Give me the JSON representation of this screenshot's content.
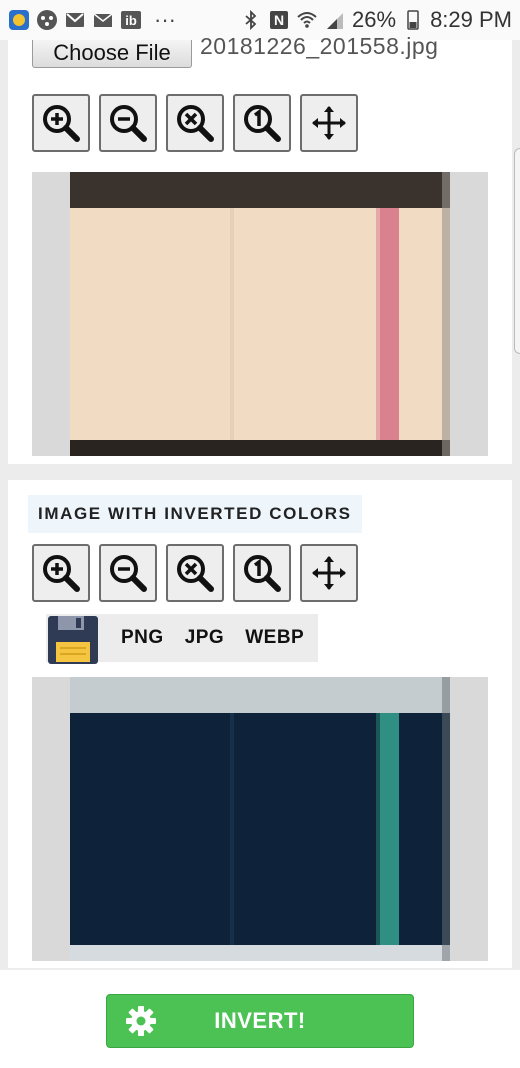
{
  "status_bar": {
    "battery": "26%",
    "time": "8:29 PM",
    "icons": [
      "app-icon",
      "game-controller-icon",
      "gmail-icon",
      "mail-icon",
      "ib-icon",
      "more-dots-icon",
      "bluetooth-icon",
      "nfc-icon",
      "wifi-icon",
      "signal-icon",
      "battery-icon"
    ],
    "more_label": "···",
    "ib_label": "ib",
    "nfc_label": "N"
  },
  "upload": {
    "choose_file_label": "Choose File",
    "file_name": "20181226_201558.jpg"
  },
  "toolbar": {
    "tools": [
      "zoom-in-icon",
      "zoom-out-icon",
      "zoom-reset-icon",
      "zoom-actual-size-icon",
      "move-arrows-icon"
    ]
  },
  "inverted_section": {
    "title": "IMAGE WITH INVERTED COLORS",
    "save_formats": [
      "PNG",
      "JPG",
      "WEBP"
    ]
  },
  "action": {
    "invert_label": "INVERT!",
    "color": "#4cc255"
  },
  "colors": {
    "original_test_strip": "#f1dcc3",
    "original_line": "#d9818f",
    "inverted_test_strip": "#0e2239",
    "inverted_line": "#2f8f83"
  }
}
